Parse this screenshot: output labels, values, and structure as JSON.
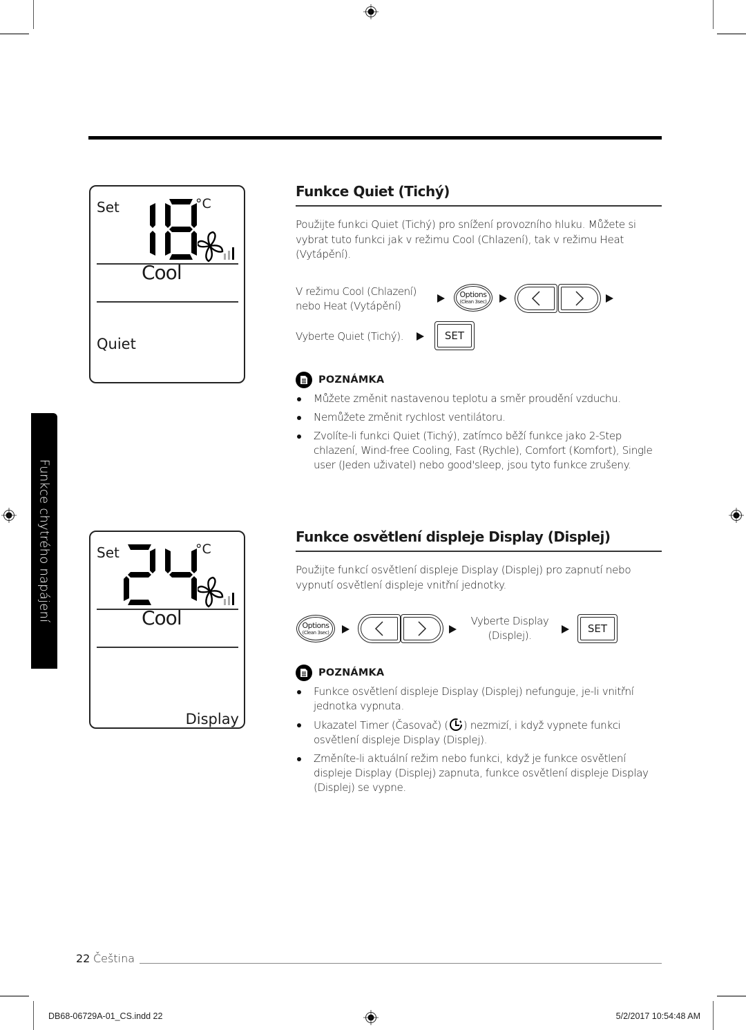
{
  "side_tab": {
    "label": "Funkce chytrého napájení"
  },
  "lcd_quiet": {
    "set_label": "Set",
    "temperature": "18",
    "unit": "°C",
    "mode": "Cool",
    "function": "Quiet",
    "fan_level_bars": 3,
    "fan_level_active": 1
  },
  "lcd_display": {
    "set_label": "Set",
    "temperature": "24",
    "unit": "°C",
    "mode": "Cool",
    "function": "Display",
    "fan_level_bars": 3,
    "fan_level_active": 1
  },
  "section_quiet": {
    "title": "Funkce Quiet (Tichý)",
    "intro": "Použijte funkci Quiet (Tichý) pro snížení provozního hluku. Můžete si vybrat tuto funkci jak v režimu Cool (Chlazení), tak v režimu Heat (Vytápění).",
    "step1_line1": "V režimu Cool (Chlazení)",
    "step1_line2": "nebo Heat (Vytápění)",
    "step2_text": "Vyberte Quiet (Tichý).",
    "buttons": {
      "options": "Options",
      "options_sub": "(Clean 3sec)",
      "set": "SET"
    },
    "note_label": "POZNÁMKA",
    "notes": [
      "Můžete změnit nastavenou teplotu a směr proudění vzduchu.",
      "Nemůžete změnit rychlost ventilátoru.",
      "Zvolíte-li funkci Quiet (Tichý), zatímco běží funkce jako 2-Step chlazení, Wind-free Cooling, Fast (Rychle), Comfort (Komfort), Single user (Jeden uživatel) nebo good'sleep, jsou tyto funkce zrušeny."
    ]
  },
  "section_display": {
    "title": "Funkce osvětlení displeje Display (Displej)",
    "intro": "Použijte funkcí osvětlení displeje Display (Displej) pro zapnutí nebo vypnutí osvětlení displeje vnitřní jednotky.",
    "step_text_line1": "Vyberte Display",
    "step_text_line2": "(Displej).",
    "buttons": {
      "options": "Options",
      "options_sub": "(Clean 3sec)",
      "set": "SET"
    },
    "note_label": "POZNÁMKA",
    "notes": [
      "Funkce osvětlení displeje Display (Displej) nefunguje, je-li vnitřní jednotka vypnuta.",
      "Ukazatel Timer (Časovač) (",
      "Změníte-li aktuální režim nebo funkci, když je funkce osvětlení displeje Display (Displej) zapnuta, funkce osvětlení displeje Display (Displej) se vypne."
    ],
    "note2_suffix": ") nezmizí, i když vypnete funkci osvětlení displeje Display (Displej)."
  },
  "footer": {
    "page_number": "22",
    "language": "Čeština",
    "slug_file": "DB68-06729A-01_CS.indd   22",
    "slug_date": "5/2/2017   10:54:48 AM"
  }
}
